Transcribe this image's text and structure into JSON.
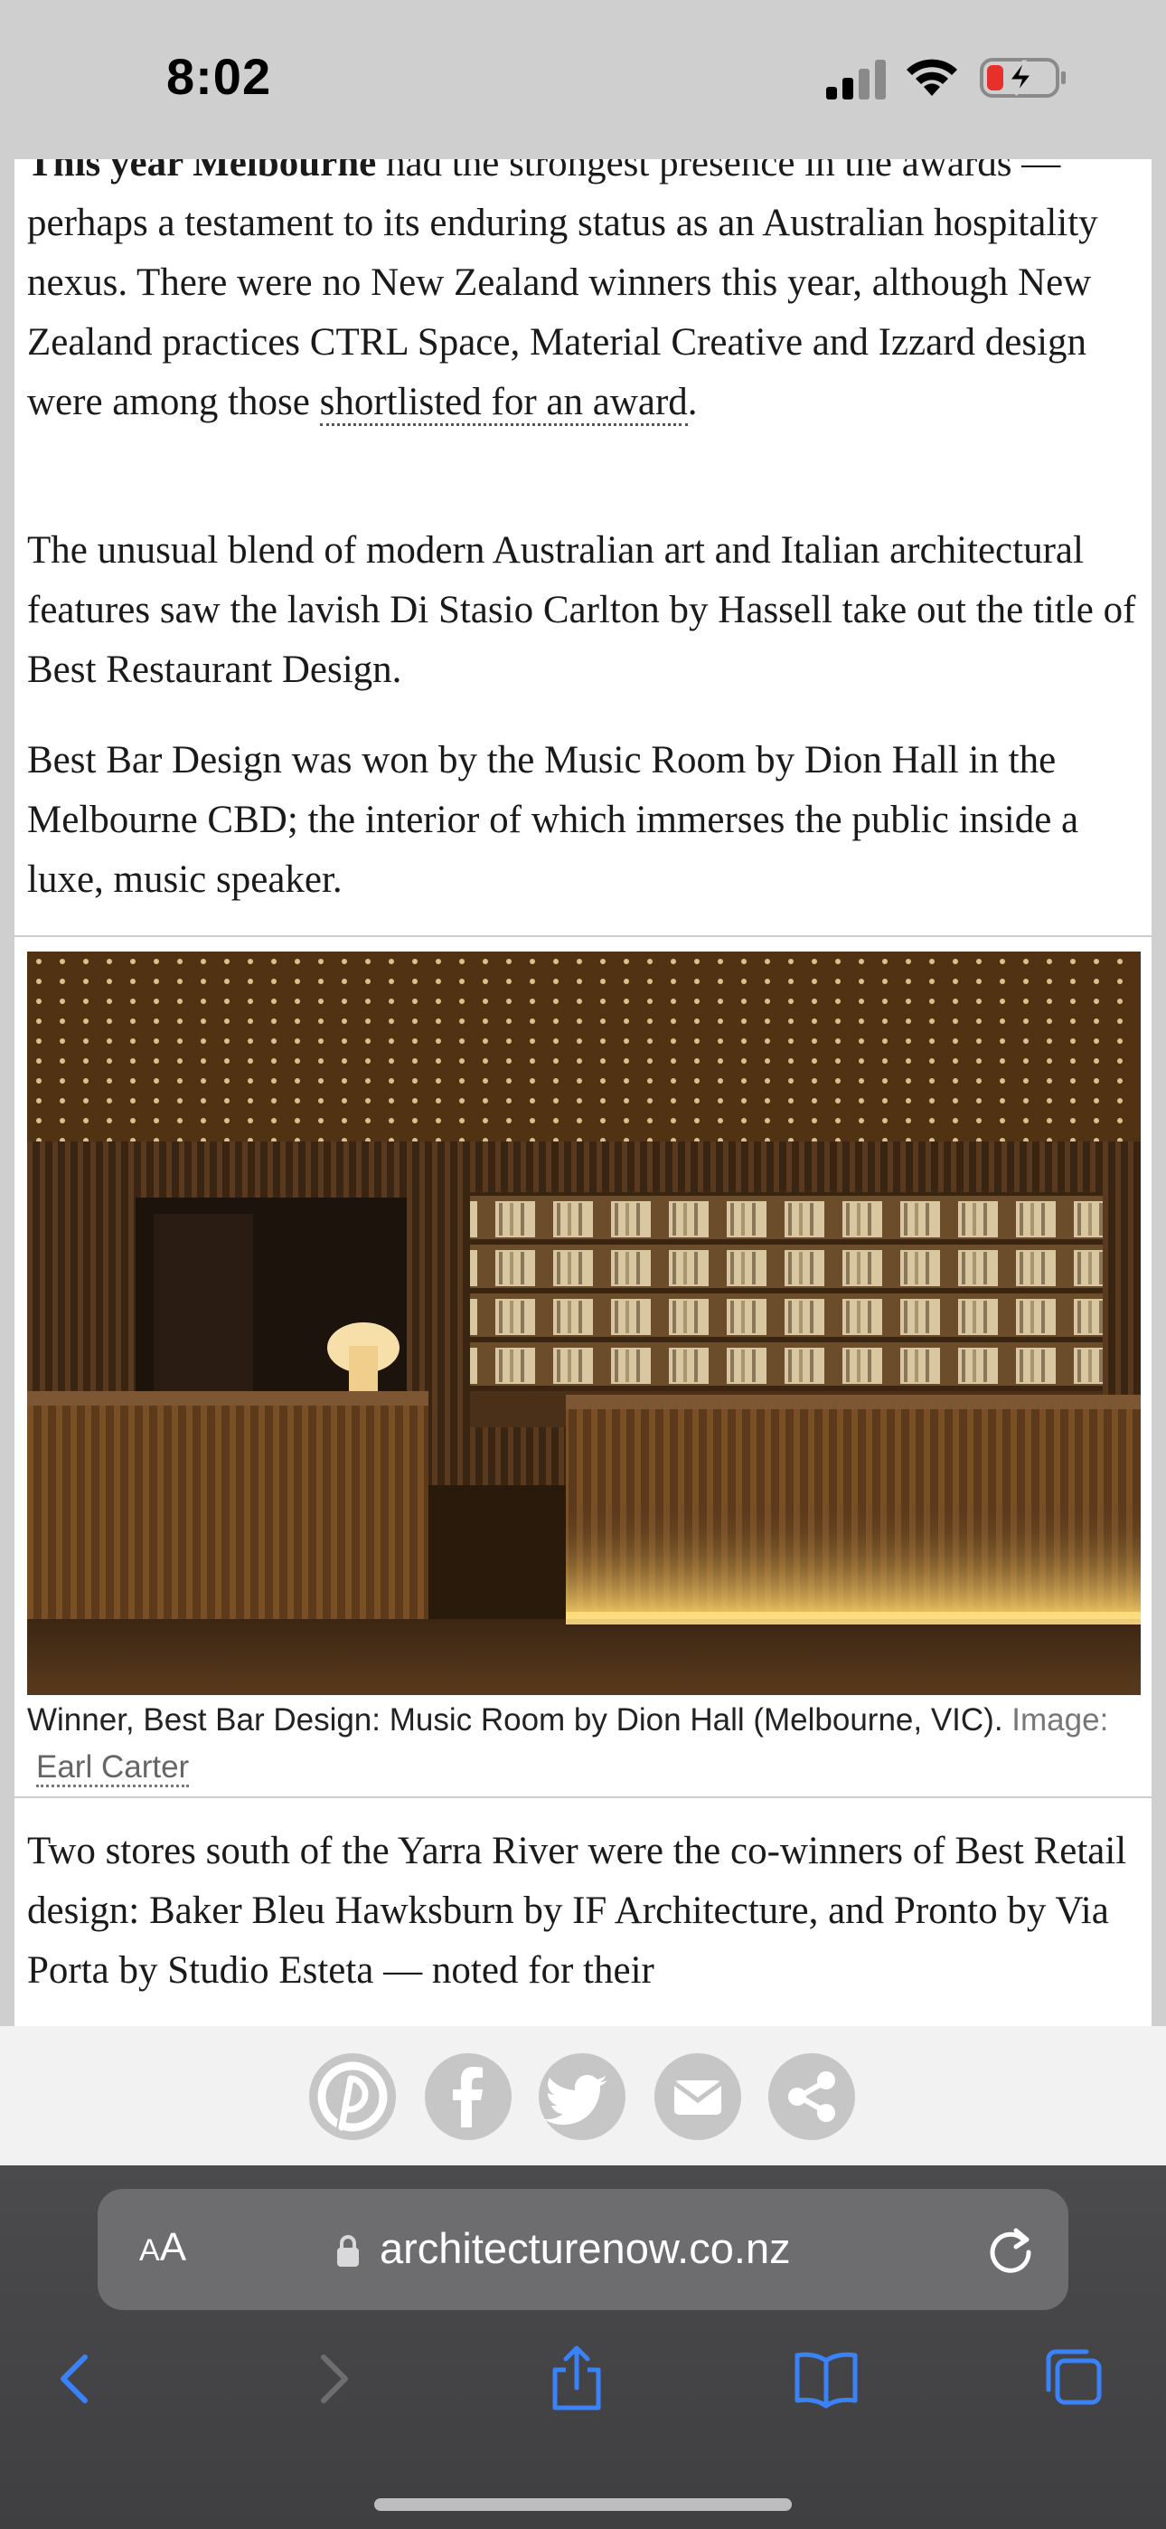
{
  "status_bar": {
    "time": "8:02",
    "battery_state": "charging-low"
  },
  "article": {
    "p1_bold": "This year Melbourne",
    "p1_text": " had the strongest presence in the awards — perhaps a testament to its enduring status as an Australian hospitality nexus. There were no New Zealand winners this year, although New Zealand practices CTRL Space, Material Creative and Izzard design were among those ",
    "p1_link": "shortlisted for an award",
    "p1_end": ".",
    "p2": "The unusual blend of modern Australian art and Italian architectural features saw the lavish Di Stasio Carlton by Hassell take out the title of Best Restaurant Design.",
    "p3": "Best Bar Design was won by the Music Room by Dion Hall in the Melbourne CBD; the interior of which immerses the public inside a luxe, music speaker.",
    "caption_text": "Winner, Best Bar Design: Music Room by Dion Hall (Melbourne, VIC).",
    "caption_image_label": "Image:",
    "caption_credit": "Earl Carter",
    "p4": "Two stores south of the Yarra River were the co-winners of Best Retail design: Baker Bleu Hawksburn by IF Architecture, and Pronto by Via Porta by Studio Esteta — noted for their"
  },
  "share": {
    "buttons": [
      "pinterest-icon",
      "facebook-icon",
      "twitter-icon",
      "email-icon",
      "share-icon"
    ],
    "button_color": "#c6c6c6"
  },
  "browser": {
    "aa_small": "A",
    "aa_big": "A",
    "url": "architecturenow.co.nz",
    "toolbar": [
      "back",
      "forward",
      "share",
      "bookmarks",
      "tabs"
    ],
    "accent": "#3a82f7"
  }
}
